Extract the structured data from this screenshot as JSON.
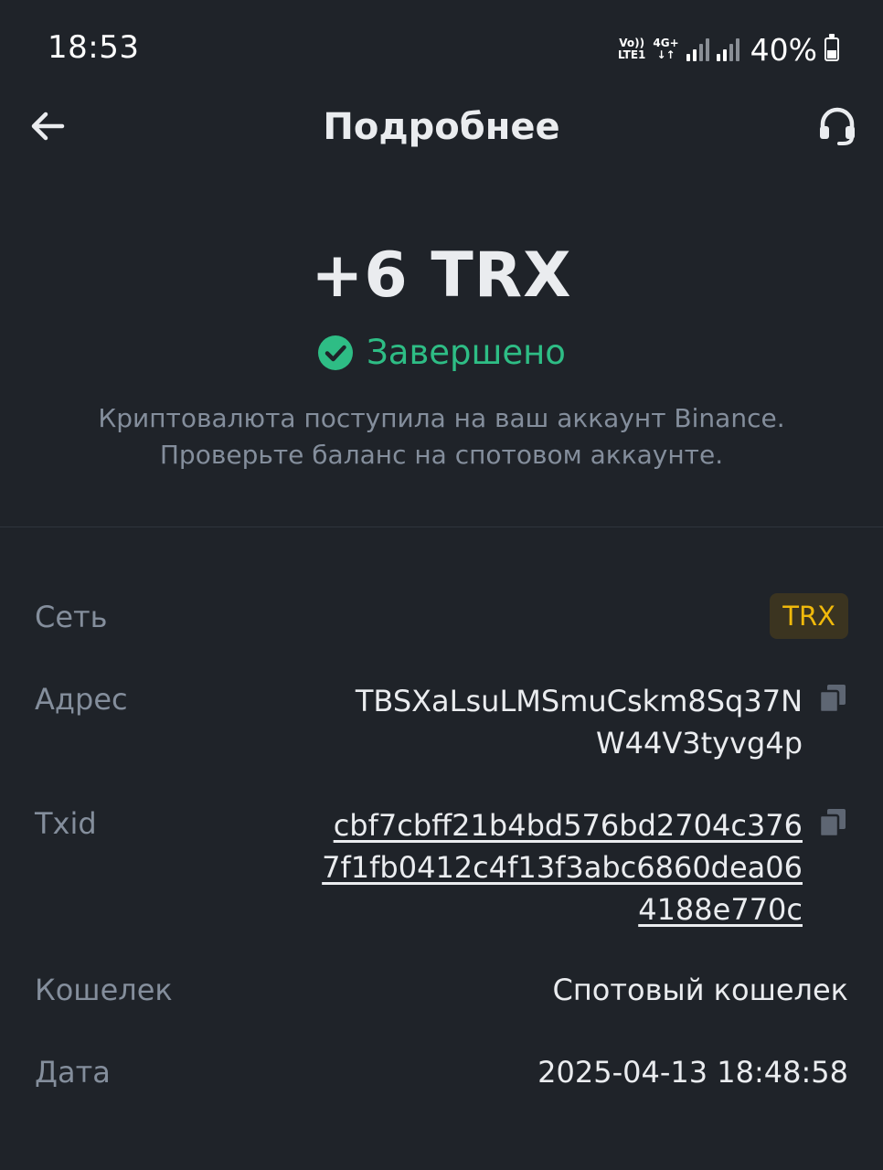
{
  "status_bar": {
    "time": "18:53",
    "volte_top": "Vo))",
    "volte_bottom": "LTE1",
    "net_top": "4G+",
    "net_bottom": "↓↑",
    "battery": "40%"
  },
  "header": {
    "title": "Подробнее",
    "back_icon": "arrow-left-icon",
    "support_icon": "headset-icon"
  },
  "summary": {
    "amount": "+6 TRX",
    "status": "Завершено",
    "status_color": "#2ebd85",
    "description": "Криптовалюта поступила на ваш аккаунт Binance. Проверьте баланс на спотовом аккаунте."
  },
  "details": {
    "network": {
      "label": "Сеть",
      "value": "TRX"
    },
    "address": {
      "label": "Адрес",
      "lines": [
        "TBSXaLsuLMSmuCskm8Sq37N",
        "W44V3tyvg4p"
      ]
    },
    "txid": {
      "label": "Txid",
      "lines": [
        "cbf7cbff21b4bd576bd2704c376",
        "7f1fb0412c4f13f3abc6860dea06",
        "4188e770c"
      ]
    },
    "wallet": {
      "label": "Кошелек",
      "value": "Спотовый кошелек"
    },
    "date": {
      "label": "Дата",
      "value": "2025-04-13 18:48:58"
    }
  },
  "colors": {
    "background": "#1f2329",
    "accent": "#f0b90b",
    "success": "#2ebd85",
    "muted": "#848e9c"
  }
}
